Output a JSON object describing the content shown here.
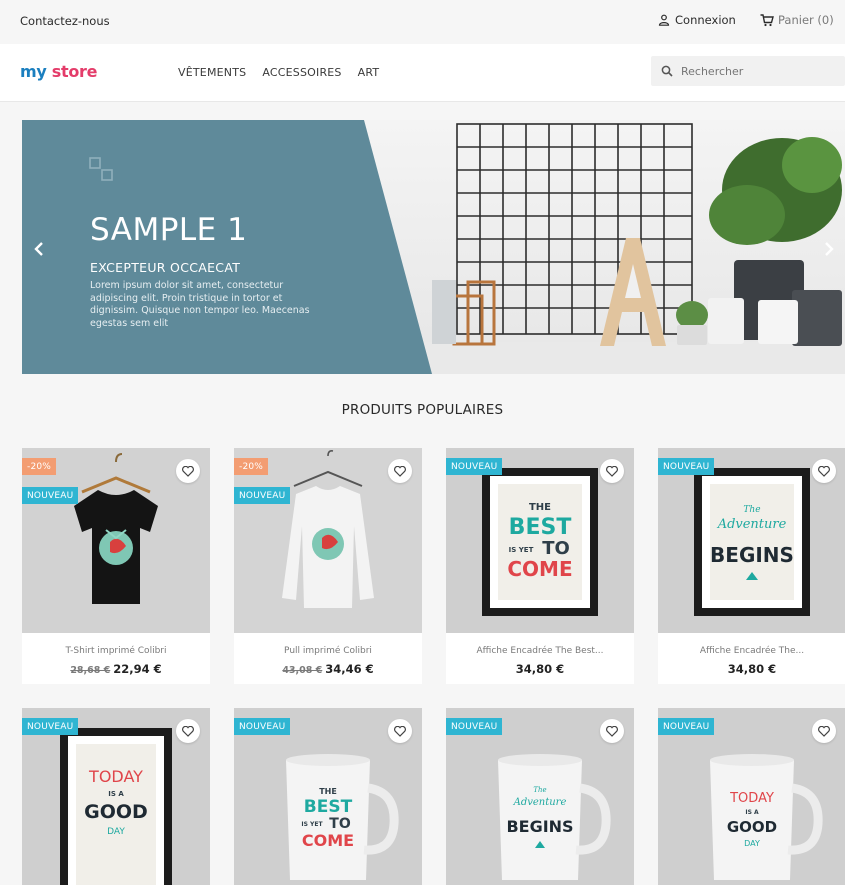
{
  "topbar": {
    "contact": "Contactez-nous",
    "login": "Connexion",
    "cart": "Panier (0)"
  },
  "header": {
    "logo_part1": "my",
    "logo_part2": "store",
    "nav": [
      "VÊTEMENTS",
      "ACCESSOIRES",
      "ART"
    ],
    "search_placeholder": "Rechercher"
  },
  "hero": {
    "title": "SAMPLE 1",
    "subtitle": "EXCEPTEUR OCCAECAT",
    "description": "Lorem ipsum dolor sit amet, consectetur adipiscing elit. Proin tristique in tortor et dignissim. Quisque non tempor leo. Maecenas egestas sem elit"
  },
  "section": {
    "title": "PRODUITS POPULAIRES"
  },
  "products": [
    {
      "name": "T-Shirt imprimé Colibri",
      "old_price": "28,68 €",
      "price": "22,94 €",
      "discount": "-20%",
      "flag": "NOUVEAU"
    },
    {
      "name": "Pull imprimé Colibri",
      "old_price": "43,08 €",
      "price": "34,46 €",
      "discount": "-20%",
      "flag": "NOUVEAU"
    },
    {
      "name": "Affiche Encadrée The Best...",
      "price": "34,80 €",
      "flag": "NOUVEAU"
    },
    {
      "name": "Affiche Encadrée The...",
      "price": "34,80 €",
      "flag": "NOUVEAU"
    },
    {
      "flag": "NOUVEAU"
    },
    {
      "flag": "NOUVEAU"
    },
    {
      "flag": "NOUVEAU"
    },
    {
      "flag": "NOUVEAU"
    }
  ],
  "artwork": {
    "best_line1": "THE",
    "best_line2": "BEST",
    "best_line3": "IS YET",
    "best_line4": "TO",
    "best_line5": "COME",
    "adv_line1": "The",
    "adv_line2": "Adventure",
    "adv_line3": "BEGINS",
    "today_line1": "TODAY",
    "today_line2": "IS A",
    "today_line3": "GOOD",
    "today_line4": "DAY"
  },
  "colors": {
    "accent": "#2fb5d2",
    "discount": "#f39d72",
    "hero_panel": "#5f8a9a",
    "logo_blue": "#1b7fbf",
    "logo_pink": "#e43c6a"
  }
}
